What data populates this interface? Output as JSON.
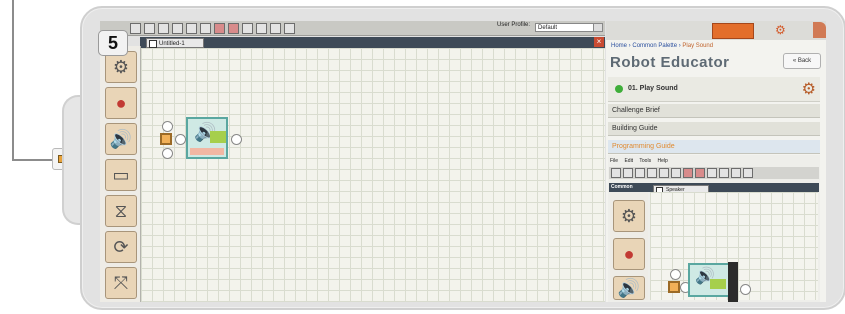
{
  "step_badge": "5",
  "toolbar": {
    "user_profile_label": "User Profile:",
    "user_profile_value": "Default"
  },
  "document": {
    "tab_label": "Untitled-1",
    "close_glyph": "×"
  },
  "palette": {
    "items": [
      {
        "name": "move-block",
        "icon": "⚙"
      },
      {
        "name": "record-play-block",
        "icon": "●"
      },
      {
        "name": "sound-block",
        "icon": "🔊"
      },
      {
        "name": "display-block",
        "icon": "▭"
      },
      {
        "name": "wait-block",
        "icon": "⧖"
      },
      {
        "name": "loop-block",
        "icon": "⟳"
      },
      {
        "name": "switch-block",
        "icon": "⤧"
      }
    ]
  },
  "right_panel": {
    "breadcrumb": {
      "home": "Home",
      "sep": " › ",
      "palette": "Common Palette",
      "current": "Play Sound"
    },
    "title": "Robot Educator",
    "back_label": "« Back",
    "lesson_label": "01. Play Sound",
    "guides": [
      "Challenge Brief",
      "Building Guide",
      "Programming Guide"
    ]
  },
  "mini_window": {
    "menu": [
      "File",
      "Edit",
      "Tools",
      "Help"
    ],
    "palette_label": "Common",
    "tab_label": "Speaker"
  },
  "colors": {
    "accent_orange": "#e36e2b",
    "grid_bg": "#f3f3ec",
    "block_teal": "#5aa7a0"
  }
}
